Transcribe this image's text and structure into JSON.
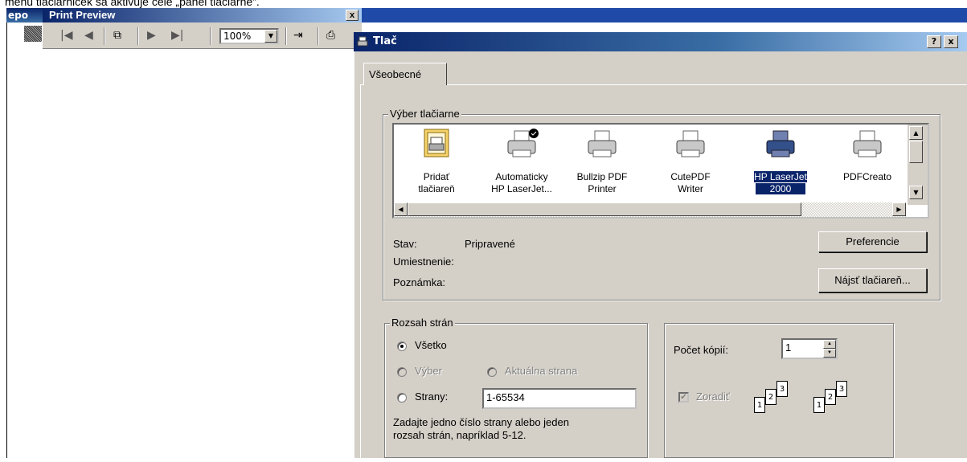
{
  "doc_text": "menu tlačiarniček sa aktivuje  celé „panel tlačiarne“.",
  "side_window": {
    "title": "epo"
  },
  "print_preview": {
    "title": "Print Preview",
    "close": "x",
    "zoom": "100%",
    "toolbar_icons": [
      "first-page-icon",
      "prev-page-icon",
      "multipage-icon",
      "next-page-icon",
      "last-page-icon",
      "exit-icon",
      "print-icon"
    ]
  },
  "dialog": {
    "title": "Tlač",
    "help": "?",
    "close": "x",
    "tab": "Všeobecné",
    "printer_group": "Výber tlačiarne",
    "printers": [
      {
        "line1": "Pridať",
        "line2": "tlačiareň",
        "icon": "add-printer-icon"
      },
      {
        "line1": "Automaticky",
        "line2": "HP LaserJet...",
        "icon": "default-printer-icon"
      },
      {
        "line1": "Bullzip PDF",
        "line2": "Printer",
        "icon": "printer-icon"
      },
      {
        "line1": "CutePDF",
        "line2": "Writer",
        "icon": "printer-icon"
      },
      {
        "line1": "HP LaserJet",
        "line2": "2000",
        "icon": "printer-icon",
        "selected": true
      },
      {
        "line1": "PDFCreato",
        "line2": "",
        "icon": "printer-icon"
      }
    ],
    "status_label": "Stav:",
    "status_value": "Pripravené",
    "location_label": "Umiestnenie:",
    "comment_label": "Poznámka:",
    "preferences_button": "Preferencie",
    "find_printer_button": "Nájsť tlačiareň...",
    "range_group": "Rozsah strán",
    "range_all": "Všetko",
    "range_selection": "Výber",
    "range_current": "Aktuálna strana",
    "range_pages": "Strany:",
    "pages_value": "1-65534",
    "range_hint_1": "Zadajte jedno číslo strany alebo jeden",
    "range_hint_2": "rozsah strán, napríklad 5-12.",
    "copies_label": "Počet kópií:",
    "copies_value": "1",
    "collate_label": "Zoradiť",
    "collate_pages": [
      "1",
      "2",
      "3"
    ]
  }
}
